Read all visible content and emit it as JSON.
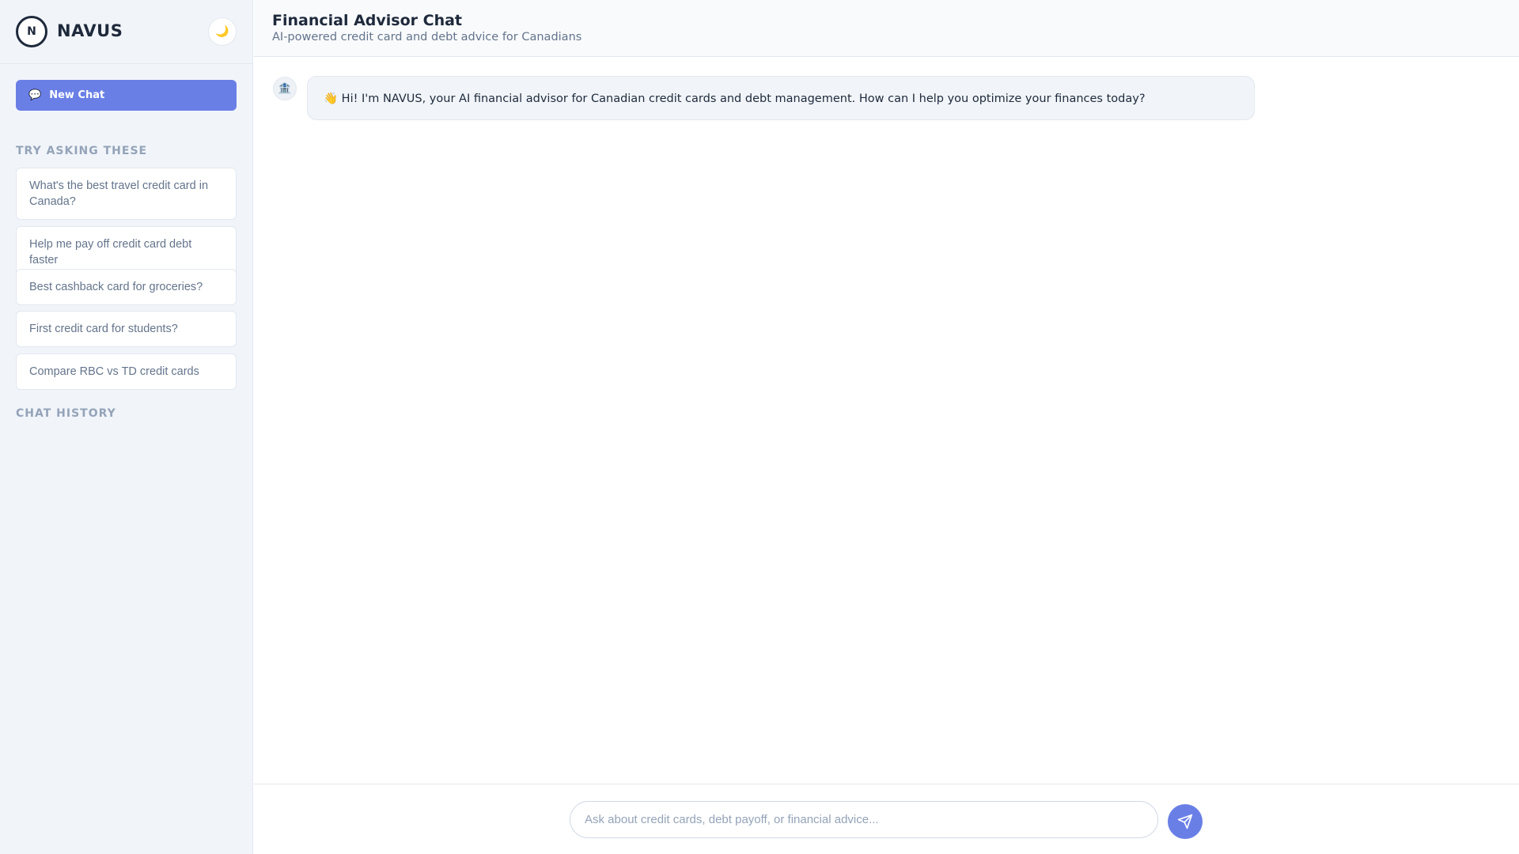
{
  "sidebar": {
    "logo_letter": "N",
    "brand": "NAVUS",
    "theme_toggle_icon": "moon-icon",
    "new_chat": {
      "icon": "chat-bubble-icon",
      "label": "New Chat"
    },
    "suggestions_label": "TRY ASKING THESE",
    "suggestions": [
      {
        "label": "What's the best travel credit card in Canada?"
      },
      {
        "label": "Help me pay off credit card debt faster"
      },
      {
        "label": "Best cashback card for groceries?"
      },
      {
        "label": "First credit card for students?"
      },
      {
        "label": "Compare RBC vs TD credit cards"
      }
    ],
    "history_label": "CHAT HISTORY"
  },
  "header": {
    "title": "Financial Advisor Chat",
    "subtitle": "AI-powered credit card and debt advice for Canadians"
  },
  "messages": [
    {
      "role": "assistant",
      "avatar_icon": "bank-icon",
      "text": "👋 Hi! I'm NAVUS, your AI financial advisor for Canadian credit cards and debt management. How can I help you optimize your finances today?"
    }
  ],
  "composer": {
    "placeholder": "Ask about credit cards, debt payoff, or financial advice...",
    "value": "",
    "send_icon": "send-icon"
  },
  "colors": {
    "accent": "#6a7fe6",
    "sidebar_bg": "#f1f5fa",
    "text_primary": "#1e293b",
    "text_muted": "#64748b",
    "label_muted": "#94a3b8"
  }
}
